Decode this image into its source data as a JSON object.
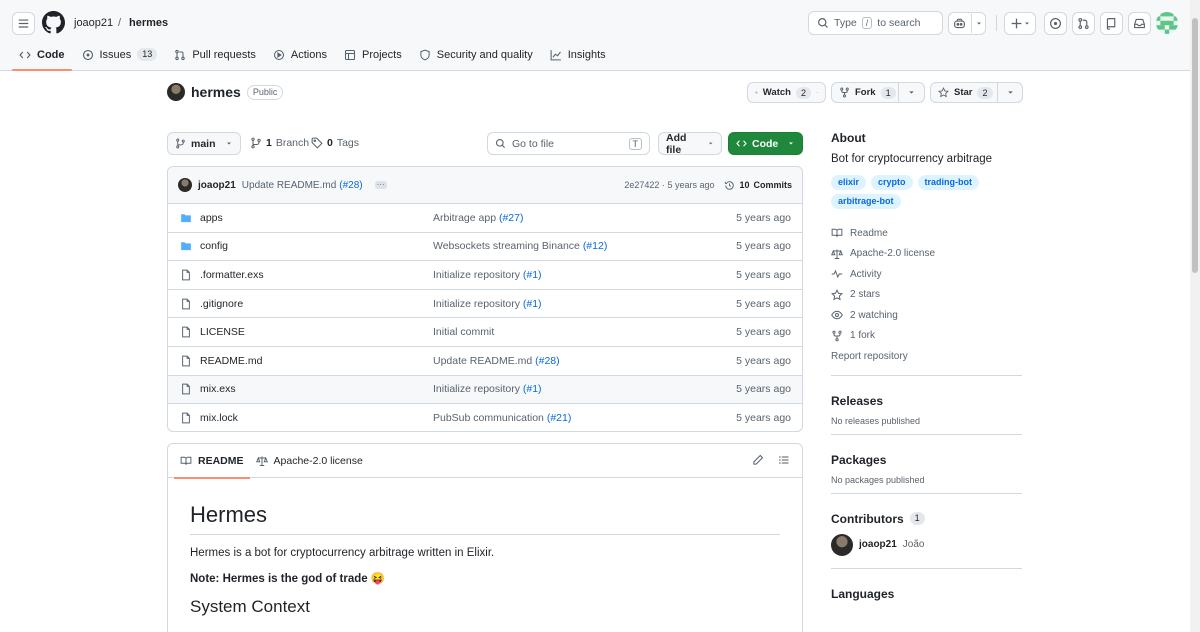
{
  "header": {
    "owner": "joaop21",
    "separator": "/",
    "repo": "hermes",
    "search_prefix": "Type",
    "search_key": "/",
    "search_suffix": "to search"
  },
  "nav": [
    {
      "label": "Code",
      "icon": "code-icon",
      "active": true
    },
    {
      "label": "Issues",
      "icon": "issue-icon",
      "count": "13"
    },
    {
      "label": "Pull requests",
      "icon": "pull-request-icon"
    },
    {
      "label": "Actions",
      "icon": "play-icon"
    },
    {
      "label": "Projects",
      "icon": "table-icon"
    },
    {
      "label": "Security and quality",
      "icon": "shield-icon"
    },
    {
      "label": "Insights",
      "icon": "graph-icon"
    }
  ],
  "repo": {
    "name": "hermes",
    "visibility": "Public",
    "watch_label": "Watch",
    "watch_count": "2",
    "fork_label": "Fork",
    "fork_count": "1",
    "star_label": "Star",
    "star_count": "2"
  },
  "toolbar": {
    "branch": "main",
    "branches_count": "1",
    "branches_label": "Branch",
    "tags_count": "0",
    "tags_label": "Tags",
    "goto_placeholder": "Go to file",
    "goto_key": "T",
    "add_file": "Add file",
    "code": "Code"
  },
  "commit": {
    "user": "joaop21",
    "message": "Update README.md",
    "pr": "(#28)",
    "hash": "2e27422",
    "sep": "·",
    "age": "5 years ago",
    "commits_count": "10",
    "commits_label": "Commits"
  },
  "files": [
    {
      "name": "apps",
      "type": "dir",
      "msg": "Arbitrage app",
      "pr": "(#27)",
      "age": "5 years ago"
    },
    {
      "name": "config",
      "type": "dir",
      "msg": "Websockets streaming Binance",
      "pr": "(#12)",
      "age": "5 years ago"
    },
    {
      "name": ".formatter.exs",
      "type": "file",
      "msg": "Initialize repository",
      "pr": "(#1)",
      "age": "5 years ago"
    },
    {
      "name": ".gitignore",
      "type": "file",
      "msg": "Initialize repository",
      "pr": "(#1)",
      "age": "5 years ago"
    },
    {
      "name": "LICENSE",
      "type": "file",
      "msg": "Initial commit",
      "pr": "",
      "age": "5 years ago"
    },
    {
      "name": "README.md",
      "type": "file",
      "msg": "Update README.md",
      "pr": "(#28)",
      "age": "5 years ago"
    },
    {
      "name": "mix.exs",
      "type": "file",
      "msg": "Initialize repository",
      "pr": "(#1)",
      "age": "5 years ago"
    },
    {
      "name": "mix.lock",
      "type": "file",
      "msg": "PubSub communication",
      "pr": "(#21)",
      "age": "5 years ago"
    }
  ],
  "readme": {
    "tab_readme": "README",
    "tab_license": "Apache-2.0 license",
    "h1": "Hermes",
    "p1": "Hermes is a bot for cryptocurrency arbitrage written in Elixir.",
    "p2": "Note: Hermes is the god of trade 😝",
    "h2": "System Context"
  },
  "about": {
    "heading": "About",
    "description": "Bot for cryptocurrency arbitrage",
    "topics": [
      "elixir",
      "crypto",
      "trading-bot",
      "arbitrage-bot"
    ],
    "links": [
      {
        "label": "Readme",
        "icon": "book-icon"
      },
      {
        "label": "Apache-2.0 license",
        "icon": "law-icon"
      },
      {
        "label": "Activity",
        "icon": "pulse-icon"
      },
      {
        "label": "2 stars",
        "icon": "star-icon"
      },
      {
        "label": "2 watching",
        "icon": "eye-icon"
      },
      {
        "label": "1 fork",
        "icon": "fork-icon"
      }
    ],
    "report": "Report repository"
  },
  "releases": {
    "heading": "Releases",
    "empty": "No releases published"
  },
  "packages": {
    "heading": "Packages",
    "empty": "No packages published"
  },
  "contributors": {
    "heading": "Contributors",
    "count": "1",
    "user": "joaop21",
    "name": "João"
  },
  "languages": {
    "heading": "Languages"
  }
}
